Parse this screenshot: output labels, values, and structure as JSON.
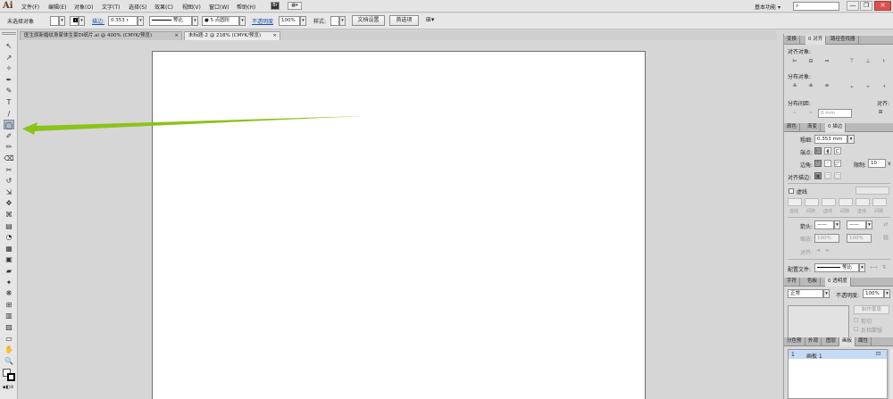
{
  "app": {
    "logo": "Ai"
  },
  "menu": [
    "文件(F)",
    "编辑(E)",
    "对象(O)",
    "文字(T)",
    "选择(S)",
    "效果(C)",
    "视图(V)",
    "窗口(W)",
    "帮助(H)"
  ],
  "menu_extra": {
    "br_label": "Br",
    "layout_label": "▦▾"
  },
  "workspace": {
    "label": "基本功能",
    "arrow": "▾"
  },
  "search": {
    "icon": "search-icon",
    "placeholder": ""
  },
  "window_buttons": {
    "minimize": "—",
    "restore": "❐",
    "close": "✕"
  },
  "control_bar": {
    "selection": "未选择对象",
    "stroke_label": "描边:",
    "stroke_value": "0.353 r",
    "stroke_profile": "等比",
    "brush": "5 点圆形",
    "opacity_label": "不透明度",
    "opacity_value": "100%",
    "style_label": "样式:",
    "doc_settings": "文档设置",
    "preferences": "首选项"
  },
  "doc_tabs": [
    {
      "title": "医生原新婚纹身家体生豪DI纸片.ai @ 400% (CMYK/预览)",
      "close": "×",
      "active": false
    },
    {
      "title": "未标题-2 @ 218% (CMYK/预览)",
      "close": "×",
      "active": true
    }
  ],
  "tools": [
    "↖",
    "↗",
    "✧",
    "✒",
    "✎",
    "T",
    "/",
    "◯",
    "✐",
    "✏",
    "⌫",
    "✂",
    "↺",
    "⇲",
    "✥",
    "⌘",
    "▤",
    "◔",
    "▦",
    "▣",
    "▰",
    "✦",
    "❋",
    "⊞",
    "▥",
    "▨",
    "▭",
    "✋",
    "🔍"
  ],
  "align_panel": {
    "tabs": [
      "变换",
      "0 对齐",
      "路径查找器"
    ],
    "align_objects": "对齐对象:",
    "distribute_objects": "分布对象:",
    "distribute_spacing": "分布间距:",
    "align_to": "对齐:",
    "spacing_value": "0 mm",
    "align_icons": [
      "⊨",
      "⊟",
      "⫤",
      "⊤",
      "⊥",
      "⊦"
    ],
    "distribute_icons": [
      "≚",
      "≙",
      "≘",
      "⫠",
      "⫟",
      "⫞"
    ]
  },
  "stroke_panel": {
    "tabs": [
      "颜色",
      "渐变",
      "0 描边"
    ],
    "weight_label": "粗细:",
    "weight_value": "0.353 mm",
    "cap_label": "端点:",
    "corner_label": "边角:",
    "limit_label": "限制:",
    "limit_value": "10",
    "limit_unit": "x",
    "align_stroke_label": "对齐描边:",
    "dashed_label": "虚线",
    "dash_sublabels": [
      "虚线",
      "间隙",
      "虚线",
      "间隙",
      "虚线",
      "间隙"
    ],
    "arrow_label": "箭头:",
    "scale_label": "缩放:",
    "scale_value_1": "100%",
    "scale_value_2": "100%",
    "align_label": "对齐:",
    "profile_label": "配置文件:",
    "profile_value": "等比"
  },
  "transparency_panel": {
    "tabs": [
      "字符",
      "色板",
      "0 透明度"
    ],
    "mode": "正常",
    "opacity_label": "不透明度:",
    "opacity_value": "100%",
    "make_mask": "制作蒙版",
    "clip": "剪切",
    "invert": "反相蒙版"
  },
  "artboards_panel": {
    "tabs": [
      "分色预",
      "外观",
      "图层",
      "画板",
      "属性"
    ],
    "rows": [
      {
        "index": "1",
        "name": "画板 1"
      }
    ]
  },
  "colors": {
    "accent_arrow": "#8cc21a",
    "selected_tab": "#e2e2e2",
    "row_highlight": "#c5daf5"
  }
}
